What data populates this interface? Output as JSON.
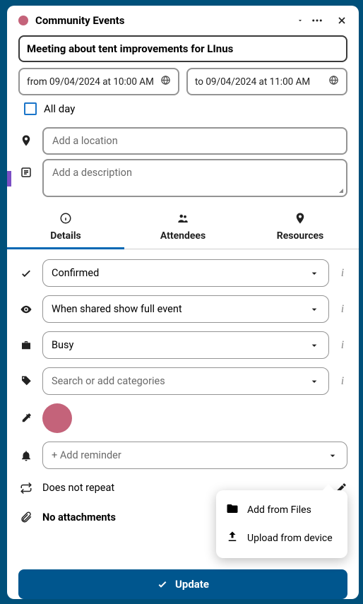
{
  "calendar": {
    "name": "Community Events",
    "dot_color": "#c4637a"
  },
  "event": {
    "title": "Meeting about tent improvements for LInus",
    "from": "from 09/04/2024 at 10:00 AM",
    "to": "to 09/04/2024 at 11:00 AM",
    "all_day_label": "All day",
    "location_placeholder": "Add a location",
    "description_placeholder": "Add a description"
  },
  "tabs": {
    "details": "Details",
    "attendees": "Attendees",
    "resources": "Resources"
  },
  "details": {
    "status": "Confirmed",
    "visibility": "When shared show full event",
    "availability": "Busy",
    "categories_placeholder": "Search or add categories",
    "reminder_placeholder": "+ Add reminder",
    "repeat": "Does not repeat",
    "attachments_label": "No attachments",
    "color": "#c4637a"
  },
  "attach_menu": {
    "files": "Add from Files",
    "device": "Upload from device"
  },
  "update_label": "Update"
}
